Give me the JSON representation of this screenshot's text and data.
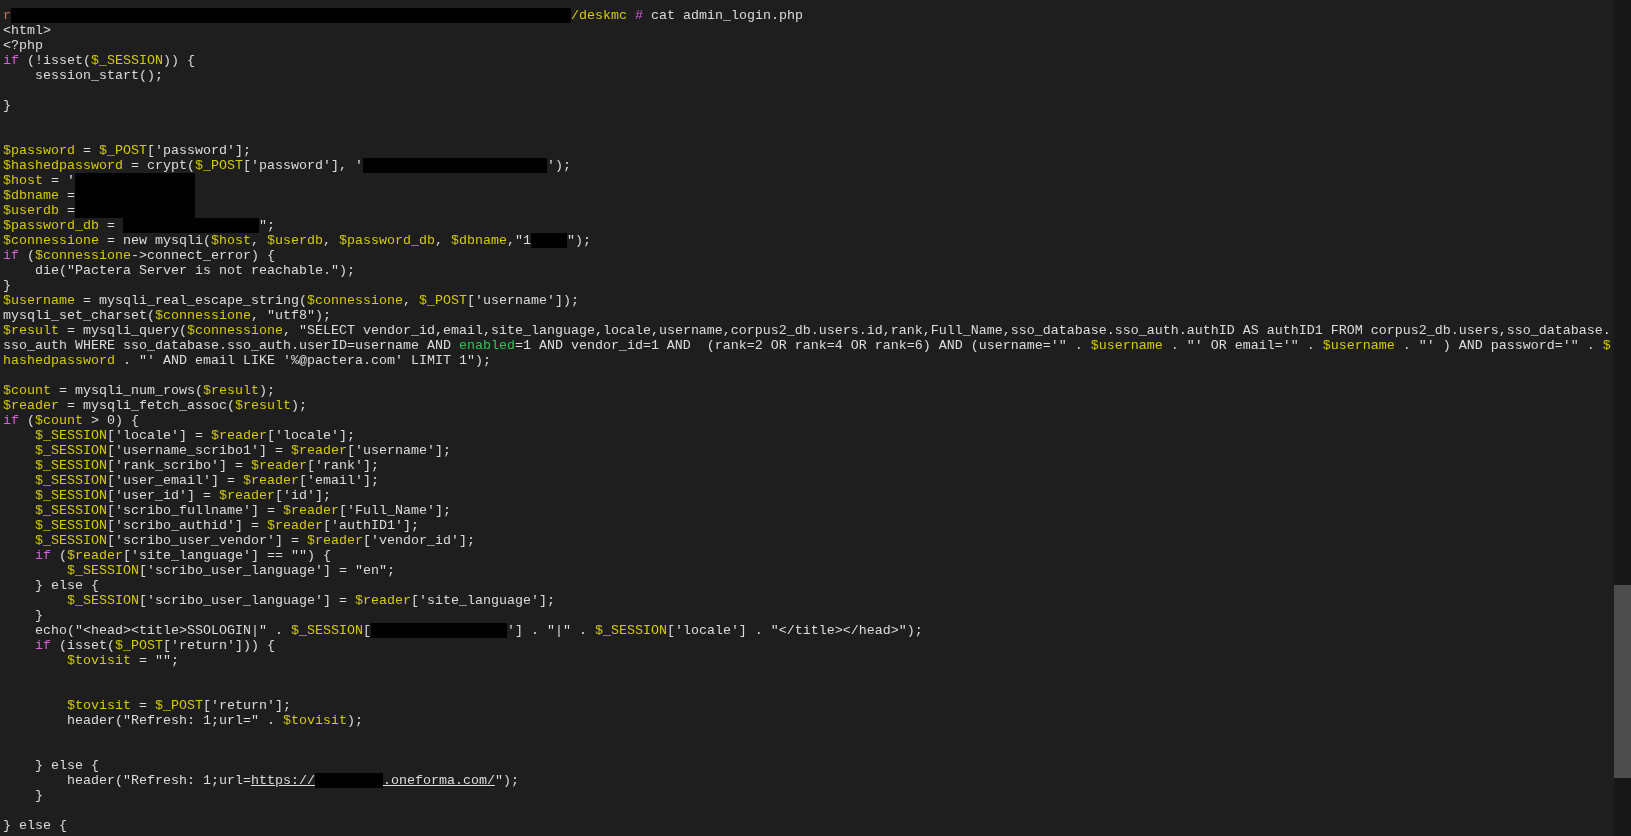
{
  "terminal": {
    "lines": [
      {
        "kind": "code",
        "segments": [
          {
            "kind": "user",
            "text": "r"
          },
          {
            "kind": "redaction"
          },
          {
            "kind": "variable",
            "text": "/deskmc "
          },
          {
            "kind": "keyword",
            "text": "#"
          },
          {
            "kind": "plain",
            "text": " cat admin_login.php"
          }
        ]
      },
      {
        "kind": "code",
        "segments": [
          {
            "kind": "plain",
            "text": "<html>"
          }
        ]
      },
      {
        "kind": "code",
        "segments": [
          {
            "kind": "plain",
            "text": "<?php"
          }
        ]
      },
      {
        "kind": "code",
        "segments": [
          {
            "kind": "keyword",
            "text": "if"
          },
          {
            "kind": "plain",
            "text": " (!isset("
          },
          {
            "kind": "variable",
            "text": "$_SESSION"
          },
          {
            "kind": "plain",
            "text": ")) {"
          }
        ]
      },
      {
        "kind": "code",
        "segments": [
          {
            "kind": "plain",
            "text": "    session_start();"
          }
        ]
      },
      {
        "kind": "blank"
      },
      {
        "kind": "code",
        "segments": [
          {
            "kind": "plain",
            "text": "}"
          }
        ]
      },
      {
        "kind": "blank"
      },
      {
        "kind": "blank"
      },
      {
        "kind": "code",
        "segments": [
          {
            "kind": "variable",
            "text": "$password"
          },
          {
            "kind": "plain",
            "text": " = "
          },
          {
            "kind": "variable",
            "text": "$_POST"
          },
          {
            "kind": "plain",
            "text": "['password'];"
          }
        ]
      },
      {
        "kind": "code",
        "segments": [
          {
            "kind": "variable",
            "text": "$hashedpassword"
          },
          {
            "kind": "plain",
            "text": " = crypt("
          },
          {
            "kind": "variable",
            "text": "$_POST"
          },
          {
            "kind": "plain",
            "text": "['password'], '"
          },
          {
            "kind": "redaction"
          },
          {
            "kind": "plain",
            "text": "');"
          }
        ]
      },
      {
        "kind": "code",
        "segments": [
          {
            "kind": "variable",
            "text": "$host"
          },
          {
            "kind": "plain",
            "text": " = '"
          },
          {
            "kind": "redaction"
          }
        ]
      },
      {
        "kind": "code",
        "segments": [
          {
            "kind": "variable",
            "text": "$dbname"
          },
          {
            "kind": "plain",
            "text": " ="
          },
          {
            "kind": "redaction"
          }
        ]
      },
      {
        "kind": "code",
        "segments": [
          {
            "kind": "variable",
            "text": "$userdb"
          },
          {
            "kind": "plain",
            "text": " ="
          },
          {
            "kind": "redaction"
          }
        ]
      },
      {
        "kind": "code",
        "segments": [
          {
            "kind": "variable",
            "text": "$password_db"
          },
          {
            "kind": "plain",
            "text": " = "
          },
          {
            "kind": "redaction"
          },
          {
            "kind": "plain",
            "text": "\";"
          }
        ]
      },
      {
        "kind": "code",
        "segments": [
          {
            "kind": "variable",
            "text": "$connessione"
          },
          {
            "kind": "plain",
            "text": " = new mysqli("
          },
          {
            "kind": "variable",
            "text": "$host"
          },
          {
            "kind": "plain",
            "text": ", "
          },
          {
            "kind": "variable",
            "text": "$userdb"
          },
          {
            "kind": "plain",
            "text": ", "
          },
          {
            "kind": "variable",
            "text": "$password_db"
          },
          {
            "kind": "plain",
            "text": ", "
          },
          {
            "kind": "variable",
            "text": "$dbname"
          },
          {
            "kind": "plain",
            "text": ",\"1"
          },
          {
            "kind": "redaction"
          },
          {
            "kind": "plain",
            "text": "\");"
          }
        ]
      },
      {
        "kind": "code",
        "segments": [
          {
            "kind": "keyword",
            "text": "if"
          },
          {
            "kind": "plain",
            "text": " ("
          },
          {
            "kind": "variable",
            "text": "$connessione"
          },
          {
            "kind": "plain",
            "text": "->connect_error) {"
          }
        ]
      },
      {
        "kind": "code",
        "segments": [
          {
            "kind": "plain",
            "text": "    die(\"Pactera Server is not reachable.\");"
          }
        ]
      },
      {
        "kind": "code",
        "segments": [
          {
            "kind": "plain",
            "text": "}"
          }
        ]
      },
      {
        "kind": "code",
        "segments": [
          {
            "kind": "variable",
            "text": "$username"
          },
          {
            "kind": "plain",
            "text": " = mysqli_real_escape_string("
          },
          {
            "kind": "variable",
            "text": "$connessione"
          },
          {
            "kind": "plain",
            "text": ", "
          },
          {
            "kind": "variable",
            "text": "$_POST"
          },
          {
            "kind": "plain",
            "text": "['username']);"
          }
        ]
      },
      {
        "kind": "code",
        "segments": [
          {
            "kind": "plain",
            "text": "mysqli_set_charset("
          },
          {
            "kind": "variable",
            "text": "$connessione"
          },
          {
            "kind": "plain",
            "text": ", \"utf8\");"
          }
        ]
      },
      {
        "kind": "code",
        "segments": [
          {
            "kind": "variable",
            "text": "$result"
          },
          {
            "kind": "plain",
            "text": " = mysqli_query("
          },
          {
            "kind": "variable",
            "text": "$connessione"
          },
          {
            "kind": "plain",
            "text": ", \"SELECT vendor_id,email,site_language,locale,username,corpus2_db.users.id,rank,Full_Name,sso_database.sso_auth.authID AS authID1 FROM corpus2_db.users,sso_database."
          }
        ]
      },
      {
        "kind": "code",
        "segments": [
          {
            "kind": "plain",
            "text": "sso_auth WHERE sso_database.sso_auth.userID=username AND "
          },
          {
            "kind": "green",
            "text": "enabled"
          },
          {
            "kind": "plain",
            "text": "=1 AND vendor_id=1 AND  (rank=2 OR rank=4 OR rank=6) AND (username='\" . "
          },
          {
            "kind": "variable",
            "text": "$username"
          },
          {
            "kind": "plain",
            "text": " . \"' OR email='\" . "
          },
          {
            "kind": "variable",
            "text": "$username"
          },
          {
            "kind": "plain",
            "text": " . \"' ) AND password='\" . "
          },
          {
            "kind": "variable",
            "text": "$"
          }
        ]
      },
      {
        "kind": "code",
        "segments": [
          {
            "kind": "variable",
            "text": "hashedpassword"
          },
          {
            "kind": "plain",
            "text": " . \"' AND email LIKE '%@pactera.com' LIMIT 1\");"
          }
        ]
      },
      {
        "kind": "blank"
      },
      {
        "kind": "code",
        "segments": [
          {
            "kind": "variable",
            "text": "$count"
          },
          {
            "kind": "plain",
            "text": " = mysqli_num_rows("
          },
          {
            "kind": "variable",
            "text": "$result"
          },
          {
            "kind": "plain",
            "text": ");"
          }
        ]
      },
      {
        "kind": "code",
        "segments": [
          {
            "kind": "variable",
            "text": "$reader"
          },
          {
            "kind": "plain",
            "text": " = mysqli_fetch_assoc("
          },
          {
            "kind": "variable",
            "text": "$result"
          },
          {
            "kind": "plain",
            "text": ");"
          }
        ]
      },
      {
        "kind": "code",
        "segments": [
          {
            "kind": "keyword",
            "text": "if"
          },
          {
            "kind": "plain",
            "text": " ("
          },
          {
            "kind": "variable",
            "text": "$count"
          },
          {
            "kind": "plain",
            "text": " > 0) {"
          }
        ]
      },
      {
        "kind": "code",
        "segments": [
          {
            "kind": "variable",
            "text": "    $_SESSION"
          },
          {
            "kind": "plain",
            "text": "['locale'] = "
          },
          {
            "kind": "variable",
            "text": "$reader"
          },
          {
            "kind": "plain",
            "text": "['locale'];"
          }
        ]
      },
      {
        "kind": "code",
        "segments": [
          {
            "kind": "variable",
            "text": "    $_SESSION"
          },
          {
            "kind": "plain",
            "text": "['username_scribo1'] = "
          },
          {
            "kind": "variable",
            "text": "$reader"
          },
          {
            "kind": "plain",
            "text": "['username'];"
          }
        ]
      },
      {
        "kind": "code",
        "segments": [
          {
            "kind": "variable",
            "text": "    $_SESSION"
          },
          {
            "kind": "plain",
            "text": "['rank_scribo'] = "
          },
          {
            "kind": "variable",
            "text": "$reader"
          },
          {
            "kind": "plain",
            "text": "['rank'];"
          }
        ]
      },
      {
        "kind": "code",
        "segments": [
          {
            "kind": "variable",
            "text": "    $_SESSION"
          },
          {
            "kind": "plain",
            "text": "['user_email'] = "
          },
          {
            "kind": "variable",
            "text": "$reader"
          },
          {
            "kind": "plain",
            "text": "['email'];"
          }
        ]
      },
      {
        "kind": "code",
        "segments": [
          {
            "kind": "variable",
            "text": "    $_SESSION"
          },
          {
            "kind": "plain",
            "text": "['user_id'] = "
          },
          {
            "kind": "variable",
            "text": "$reader"
          },
          {
            "kind": "plain",
            "text": "['id'];"
          }
        ]
      },
      {
        "kind": "code",
        "segments": [
          {
            "kind": "variable",
            "text": "    $_SESSION"
          },
          {
            "kind": "plain",
            "text": "['scribo_fullname'] = "
          },
          {
            "kind": "variable",
            "text": "$reader"
          },
          {
            "kind": "plain",
            "text": "['Full_Name'];"
          }
        ]
      },
      {
        "kind": "code",
        "segments": [
          {
            "kind": "variable",
            "text": "    $_SESSION"
          },
          {
            "kind": "plain",
            "text": "['scribo_authid'] = "
          },
          {
            "kind": "variable",
            "text": "$reader"
          },
          {
            "kind": "plain",
            "text": "['authID1'];"
          }
        ]
      },
      {
        "kind": "code",
        "segments": [
          {
            "kind": "variable",
            "text": "    $_SESSION"
          },
          {
            "kind": "plain",
            "text": "['scribo_user_vendor'] = "
          },
          {
            "kind": "variable",
            "text": "$reader"
          },
          {
            "kind": "plain",
            "text": "['vendor_id'];"
          }
        ]
      },
      {
        "kind": "code",
        "segments": [
          {
            "kind": "keyword",
            "text": "    if"
          },
          {
            "kind": "plain",
            "text": " ("
          },
          {
            "kind": "variable",
            "text": "$reader"
          },
          {
            "kind": "plain",
            "text": "['site_language'] == \"\") {"
          }
        ]
      },
      {
        "kind": "code",
        "segments": [
          {
            "kind": "variable",
            "text": "        $_SESSION"
          },
          {
            "kind": "plain",
            "text": "['scribo_user_language'] = \"en\";"
          }
        ]
      },
      {
        "kind": "code",
        "segments": [
          {
            "kind": "plain",
            "text": "    } else {"
          }
        ]
      },
      {
        "kind": "code",
        "segments": [
          {
            "kind": "variable",
            "text": "        $_SESSION"
          },
          {
            "kind": "plain",
            "text": "['scribo_user_language'] = "
          },
          {
            "kind": "variable",
            "text": "$reader"
          },
          {
            "kind": "plain",
            "text": "['site_language'];"
          }
        ]
      },
      {
        "kind": "code",
        "segments": [
          {
            "kind": "plain",
            "text": "    }"
          }
        ]
      },
      {
        "kind": "code",
        "segments": [
          {
            "kind": "plain",
            "text": "    echo(\"<head><title>SSOLOGIN|\" . "
          },
          {
            "kind": "variable",
            "text": "$_SESSION"
          },
          {
            "kind": "plain",
            "text": "["
          },
          {
            "kind": "redaction"
          },
          {
            "kind": "plain",
            "text": "'] . \"|\" . "
          },
          {
            "kind": "variable",
            "text": "$_SESSION"
          },
          {
            "kind": "plain",
            "text": "['locale'] . \"</title></head>\");"
          }
        ]
      },
      {
        "kind": "code",
        "segments": [
          {
            "kind": "keyword",
            "text": "    if"
          },
          {
            "kind": "plain",
            "text": " (isset("
          },
          {
            "kind": "variable",
            "text": "$_POST"
          },
          {
            "kind": "plain",
            "text": "['return'])) {"
          }
        ]
      },
      {
        "kind": "code",
        "segments": [
          {
            "kind": "variable",
            "text": "        $tovisit"
          },
          {
            "kind": "plain",
            "text": " = \"\";"
          }
        ]
      },
      {
        "kind": "blank"
      },
      {
        "kind": "blank"
      },
      {
        "kind": "code",
        "segments": [
          {
            "kind": "variable",
            "text": "        $tovisit"
          },
          {
            "kind": "plain",
            "text": " = "
          },
          {
            "kind": "variable",
            "text": "$_POST"
          },
          {
            "kind": "plain",
            "text": "['return'];"
          }
        ]
      },
      {
        "kind": "code",
        "segments": [
          {
            "kind": "plain",
            "text": "        header(\"Refresh: 1;url=\" . "
          },
          {
            "kind": "variable",
            "text": "$tovisit"
          },
          {
            "kind": "plain",
            "text": ");"
          }
        ]
      },
      {
        "kind": "blank"
      },
      {
        "kind": "blank"
      },
      {
        "kind": "code",
        "segments": [
          {
            "kind": "plain",
            "text": "    } else {"
          }
        ]
      },
      {
        "kind": "code",
        "segments": [
          {
            "kind": "plain",
            "text": "        header(\"Refresh: 1;url="
          },
          {
            "kind": "link",
            "text": "https://"
          },
          {
            "kind": "redaction"
          },
          {
            "kind": "link",
            "text": ".oneforma.com/"
          },
          {
            "kind": "plain",
            "text": "\");"
          }
        ]
      },
      {
        "kind": "code",
        "segments": [
          {
            "kind": "plain",
            "text": "    }"
          }
        ]
      },
      {
        "kind": "blank"
      },
      {
        "kind": "code",
        "segments": [
          {
            "kind": "plain",
            "text": "} else {"
          }
        ]
      }
    ]
  }
}
